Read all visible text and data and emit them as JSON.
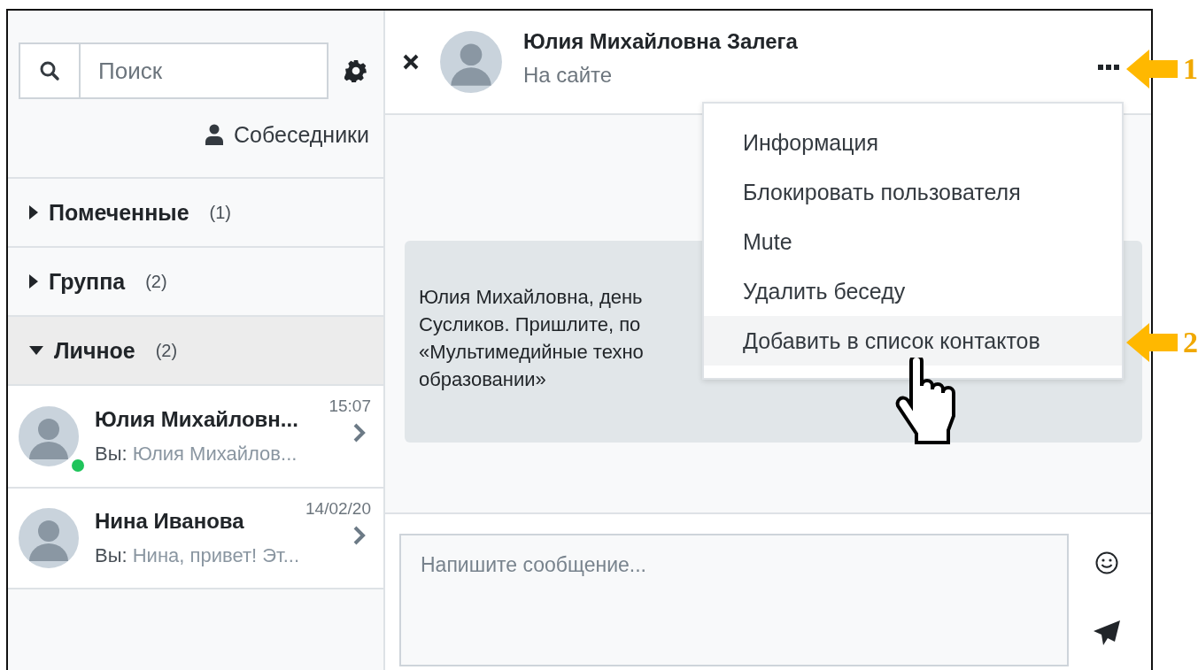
{
  "sidebar": {
    "search": {
      "placeholder": "Поиск"
    },
    "contacts_link": "Собеседники",
    "sections": [
      {
        "title": "Помеченные",
        "count": "(1)",
        "expanded": false,
        "selected": false
      },
      {
        "title": "Группа",
        "count": "(2)",
        "expanded": false,
        "selected": false
      },
      {
        "title": "Личное",
        "count": "(2)",
        "expanded": true,
        "selected": true,
        "conversations": [
          {
            "name": "Юлия Михайловн...",
            "time": "15:07",
            "sender": "Вы:",
            "preview": "Юлия Михайлов...",
            "online": true
          },
          {
            "name": "Нина Иванова",
            "time": "14/02/20",
            "sender": "Вы:",
            "preview": "Нина, привет! Эт...",
            "online": false
          }
        ]
      }
    ]
  },
  "conversation": {
    "name": "Юлия Михайловна Залега",
    "status": "На сайте",
    "message_lines": [
      "Юлия Михайловна, день",
      "Сусликов. Пришлите, по",
      "«Мультимедийные техно",
      "образовании»"
    ],
    "menu": {
      "items": [
        {
          "label": "Информация",
          "selected": false
        },
        {
          "label": "Блокировать пользователя",
          "selected": false
        },
        {
          "label": "Mute",
          "selected": false
        },
        {
          "label": "Удалить беседу",
          "selected": false
        },
        {
          "label": "Добавить в список контактов",
          "selected": true
        }
      ]
    },
    "composer": {
      "placeholder": "Напишите сообщение..."
    }
  },
  "callouts": [
    {
      "label": "1"
    },
    {
      "label": "2"
    }
  ]
}
